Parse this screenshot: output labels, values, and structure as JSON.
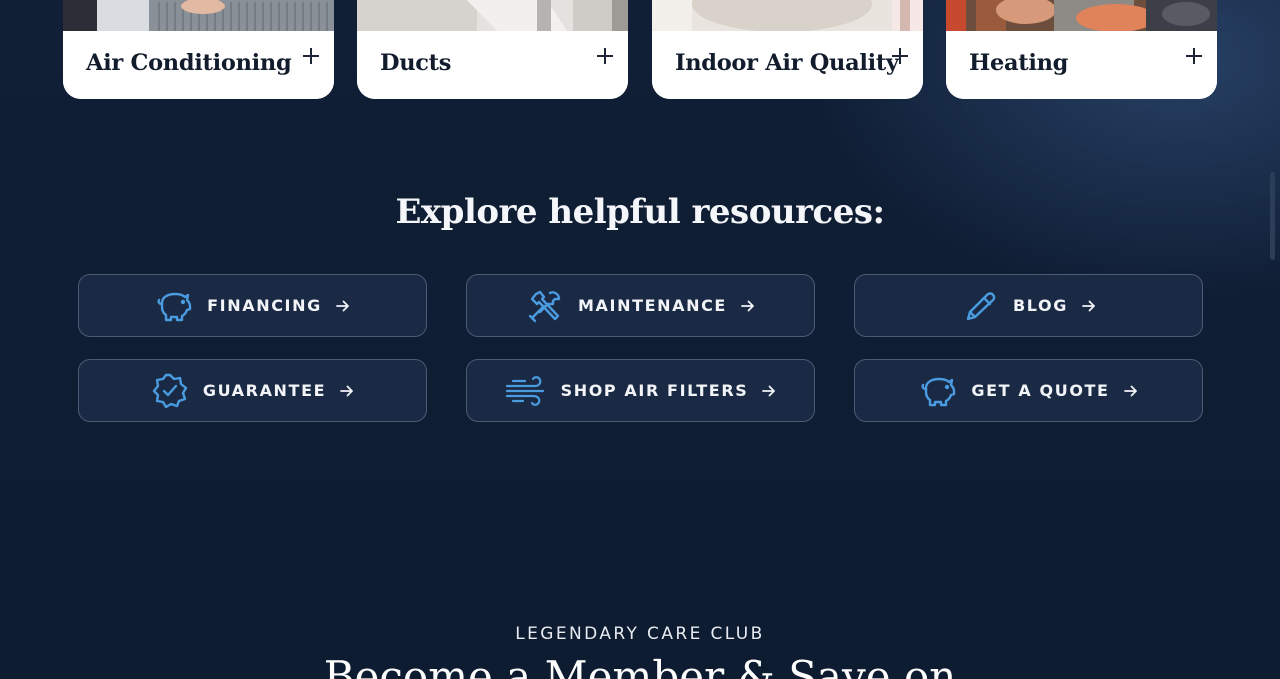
{
  "service_cards": [
    {
      "title": "Air Conditioning"
    },
    {
      "title": "Ducts"
    },
    {
      "title": "Indoor Air Quality"
    },
    {
      "title": "Heating"
    }
  ],
  "resources": {
    "title": "Explore helpful resources:",
    "buttons": [
      {
        "label": "FINANCING",
        "icon": "piggy-bank-icon"
      },
      {
        "label": "MAINTENANCE",
        "icon": "tools-icon"
      },
      {
        "label": "BLOG",
        "icon": "pencil-icon"
      },
      {
        "label": "GUARANTEE",
        "icon": "badge-check-icon"
      },
      {
        "label": "SHOP AIR FILTERS",
        "icon": "wind-icon"
      },
      {
        "label": "GET A QUOTE",
        "icon": "piggy-bank-icon"
      }
    ]
  },
  "club": {
    "eyebrow": "LEGENDARY CARE CLUB",
    "title": "Become a Member & Save on"
  },
  "colors": {
    "background": "#0f1d33",
    "accent_icon": "#4a9be0",
    "button_bg": "#1a2a44",
    "card_bg": "#ffffff"
  }
}
